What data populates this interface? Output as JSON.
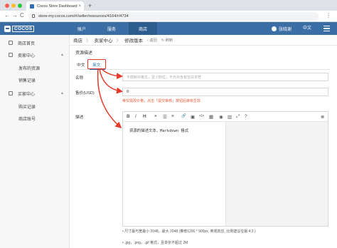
{
  "browser": {
    "tab_title": "Cocos Store Dashboard",
    "tab_close": "×",
    "new_tab": "+",
    "url": "store-my.cocos.com/#/seller/resources/4164/r/4734",
    "back": "←",
    "forward": "→",
    "reload": "C",
    "menu": "⋮"
  },
  "header": {
    "logo_text": "COCOS",
    "nav": [
      {
        "label": "账户"
      },
      {
        "label": "服务"
      },
      {
        "label": "商店"
      }
    ],
    "user_name": "张晓谢",
    "language": "中文"
  },
  "sidebar": {
    "items": [
      {
        "label": "商店首页"
      },
      {
        "label": "卖家中心",
        "caret": "▲"
      },
      {
        "label": "买家中心",
        "caret": "▲"
      }
    ],
    "seller_sub": [
      "发布的资源",
      "销售记录"
    ],
    "buyer_sub": [
      "购买记录",
      "商店账号"
    ]
  },
  "breadcrumb": {
    "items": [
      "商店",
      "卖家中心",
      "修改版本"
    ],
    "sep": "〉",
    "back": "‹ 返回",
    "refresh": "↻ 刷新"
  },
  "form": {
    "section_title": "资源描述",
    "lang_tabs": [
      "中文",
      "英文"
    ],
    "name_label": "名称",
    "name_placeholder": "不限制中英文，至少四位，不允许含有空白字符",
    "price_label": "售价(USD)",
    "price_value": "0",
    "price_hint": "等仅需改价格，点击「提交审核」按钮后审核生效",
    "desc_label": "描述",
    "editor_text": "资源的描述文本，Markdown 格式"
  },
  "toolbar": {
    "bold": "B",
    "italic": "I",
    "heading": "H",
    "quote": "❝",
    "ul": "☰",
    "ol": "≡",
    "link": "🔗",
    "image": "▣",
    "code": "</>",
    "table": "▦",
    "preview": "◉",
    "side": "▥",
    "full": "⤢",
    "help": "?",
    "more": "≣"
  },
  "notes": [
    "• 尺寸最与宽最小 2048，最大 2048 (推荐1200 * 900px, 英观效应, 比例建议在最 4:3 )",
    "• .jpg，.png，.gif 格式，且单张不超过 2M"
  ],
  "colors": {
    "header": "#3a6ea5",
    "accent": "#1e73be",
    "annotation": "#e53b2c"
  }
}
